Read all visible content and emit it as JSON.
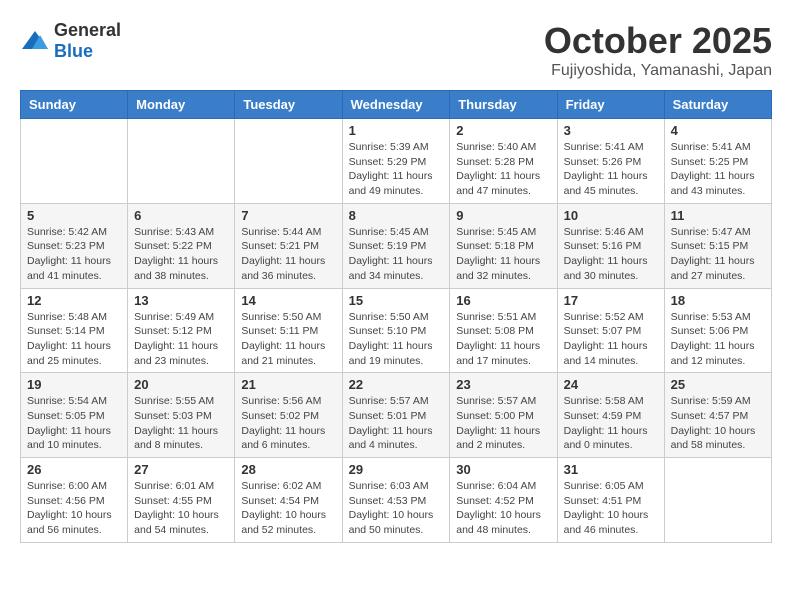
{
  "header": {
    "logo_general": "General",
    "logo_blue": "Blue",
    "month": "October 2025",
    "location": "Fujiyoshida, Yamanashi, Japan"
  },
  "weekdays": [
    "Sunday",
    "Monday",
    "Tuesday",
    "Wednesday",
    "Thursday",
    "Friday",
    "Saturday"
  ],
  "weeks": [
    [
      {
        "day": "",
        "sunrise": "",
        "sunset": "",
        "daylight": ""
      },
      {
        "day": "",
        "sunrise": "",
        "sunset": "",
        "daylight": ""
      },
      {
        "day": "",
        "sunrise": "",
        "sunset": "",
        "daylight": ""
      },
      {
        "day": "1",
        "sunrise": "Sunrise: 5:39 AM",
        "sunset": "Sunset: 5:29 PM",
        "daylight": "Daylight: 11 hours and 49 minutes."
      },
      {
        "day": "2",
        "sunrise": "Sunrise: 5:40 AM",
        "sunset": "Sunset: 5:28 PM",
        "daylight": "Daylight: 11 hours and 47 minutes."
      },
      {
        "day": "3",
        "sunrise": "Sunrise: 5:41 AM",
        "sunset": "Sunset: 5:26 PM",
        "daylight": "Daylight: 11 hours and 45 minutes."
      },
      {
        "day": "4",
        "sunrise": "Sunrise: 5:41 AM",
        "sunset": "Sunset: 5:25 PM",
        "daylight": "Daylight: 11 hours and 43 minutes."
      }
    ],
    [
      {
        "day": "5",
        "sunrise": "Sunrise: 5:42 AM",
        "sunset": "Sunset: 5:23 PM",
        "daylight": "Daylight: 11 hours and 41 minutes."
      },
      {
        "day": "6",
        "sunrise": "Sunrise: 5:43 AM",
        "sunset": "Sunset: 5:22 PM",
        "daylight": "Daylight: 11 hours and 38 minutes."
      },
      {
        "day": "7",
        "sunrise": "Sunrise: 5:44 AM",
        "sunset": "Sunset: 5:21 PM",
        "daylight": "Daylight: 11 hours and 36 minutes."
      },
      {
        "day": "8",
        "sunrise": "Sunrise: 5:45 AM",
        "sunset": "Sunset: 5:19 PM",
        "daylight": "Daylight: 11 hours and 34 minutes."
      },
      {
        "day": "9",
        "sunrise": "Sunrise: 5:45 AM",
        "sunset": "Sunset: 5:18 PM",
        "daylight": "Daylight: 11 hours and 32 minutes."
      },
      {
        "day": "10",
        "sunrise": "Sunrise: 5:46 AM",
        "sunset": "Sunset: 5:16 PM",
        "daylight": "Daylight: 11 hours and 30 minutes."
      },
      {
        "day": "11",
        "sunrise": "Sunrise: 5:47 AM",
        "sunset": "Sunset: 5:15 PM",
        "daylight": "Daylight: 11 hours and 27 minutes."
      }
    ],
    [
      {
        "day": "12",
        "sunrise": "Sunrise: 5:48 AM",
        "sunset": "Sunset: 5:14 PM",
        "daylight": "Daylight: 11 hours and 25 minutes."
      },
      {
        "day": "13",
        "sunrise": "Sunrise: 5:49 AM",
        "sunset": "Sunset: 5:12 PM",
        "daylight": "Daylight: 11 hours and 23 minutes."
      },
      {
        "day": "14",
        "sunrise": "Sunrise: 5:50 AM",
        "sunset": "Sunset: 5:11 PM",
        "daylight": "Daylight: 11 hours and 21 minutes."
      },
      {
        "day": "15",
        "sunrise": "Sunrise: 5:50 AM",
        "sunset": "Sunset: 5:10 PM",
        "daylight": "Daylight: 11 hours and 19 minutes."
      },
      {
        "day": "16",
        "sunrise": "Sunrise: 5:51 AM",
        "sunset": "Sunset: 5:08 PM",
        "daylight": "Daylight: 11 hours and 17 minutes."
      },
      {
        "day": "17",
        "sunrise": "Sunrise: 5:52 AM",
        "sunset": "Sunset: 5:07 PM",
        "daylight": "Daylight: 11 hours and 14 minutes."
      },
      {
        "day": "18",
        "sunrise": "Sunrise: 5:53 AM",
        "sunset": "Sunset: 5:06 PM",
        "daylight": "Daylight: 11 hours and 12 minutes."
      }
    ],
    [
      {
        "day": "19",
        "sunrise": "Sunrise: 5:54 AM",
        "sunset": "Sunset: 5:05 PM",
        "daylight": "Daylight: 11 hours and 10 minutes."
      },
      {
        "day": "20",
        "sunrise": "Sunrise: 5:55 AM",
        "sunset": "Sunset: 5:03 PM",
        "daylight": "Daylight: 11 hours and 8 minutes."
      },
      {
        "day": "21",
        "sunrise": "Sunrise: 5:56 AM",
        "sunset": "Sunset: 5:02 PM",
        "daylight": "Daylight: 11 hours and 6 minutes."
      },
      {
        "day": "22",
        "sunrise": "Sunrise: 5:57 AM",
        "sunset": "Sunset: 5:01 PM",
        "daylight": "Daylight: 11 hours and 4 minutes."
      },
      {
        "day": "23",
        "sunrise": "Sunrise: 5:57 AM",
        "sunset": "Sunset: 5:00 PM",
        "daylight": "Daylight: 11 hours and 2 minutes."
      },
      {
        "day": "24",
        "sunrise": "Sunrise: 5:58 AM",
        "sunset": "Sunset: 4:59 PM",
        "daylight": "Daylight: 11 hours and 0 minutes."
      },
      {
        "day": "25",
        "sunrise": "Sunrise: 5:59 AM",
        "sunset": "Sunset: 4:57 PM",
        "daylight": "Daylight: 10 hours and 58 minutes."
      }
    ],
    [
      {
        "day": "26",
        "sunrise": "Sunrise: 6:00 AM",
        "sunset": "Sunset: 4:56 PM",
        "daylight": "Daylight: 10 hours and 56 minutes."
      },
      {
        "day": "27",
        "sunrise": "Sunrise: 6:01 AM",
        "sunset": "Sunset: 4:55 PM",
        "daylight": "Daylight: 10 hours and 54 minutes."
      },
      {
        "day": "28",
        "sunrise": "Sunrise: 6:02 AM",
        "sunset": "Sunset: 4:54 PM",
        "daylight": "Daylight: 10 hours and 52 minutes."
      },
      {
        "day": "29",
        "sunrise": "Sunrise: 6:03 AM",
        "sunset": "Sunset: 4:53 PM",
        "daylight": "Daylight: 10 hours and 50 minutes."
      },
      {
        "day": "30",
        "sunrise": "Sunrise: 6:04 AM",
        "sunset": "Sunset: 4:52 PM",
        "daylight": "Daylight: 10 hours and 48 minutes."
      },
      {
        "day": "31",
        "sunrise": "Sunrise: 6:05 AM",
        "sunset": "Sunset: 4:51 PM",
        "daylight": "Daylight: 10 hours and 46 minutes."
      },
      {
        "day": "",
        "sunrise": "",
        "sunset": "",
        "daylight": ""
      }
    ]
  ]
}
